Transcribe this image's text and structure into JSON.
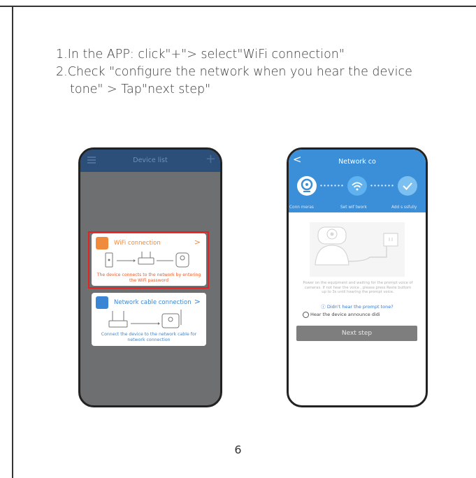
{
  "instructions": {
    "line1": "1.In the APP:  click\"+\"> select\"WiFi connection\"",
    "line2": "2.Check \"configure the network when you hear the device",
    "line3": "tone\" > Tap\"next step\""
  },
  "left_phone": {
    "title": "Device list",
    "wifi": {
      "label": "WiFi connection",
      "chevron": ">",
      "desc": "The device connects to the network by entering the WiFi password",
      "icon_color": "#f08a3c"
    },
    "cable": {
      "label": "Network cable connection",
      "chevron": ">",
      "desc": "Connect the device to the network cable for network connection",
      "icon_color": "#3a86d4"
    },
    "highlight_color": "#e02424"
  },
  "right_phone": {
    "back_glyph": "<",
    "title": "Network co",
    "steps": [
      {
        "label": "Conn  meras",
        "icon": "camera-icon"
      },
      {
        "label": "Set wif  twork",
        "icon": "wifi-icon"
      },
      {
        "label": "Add s  ssfully",
        "icon": "check-icon"
      }
    ],
    "note": "Power on the equipment and waiting for the prompt voice of cameras. If not hear the voice , please press Reste buttom up to 3s until hearing the prompt voice.",
    "prompt_link": "ⓘ Didn't hear the prompt tone?",
    "checkbox_label": "Hear the device announce didi",
    "next_button": "Next step",
    "accent": "#3b8fd8"
  },
  "page_number": "6"
}
